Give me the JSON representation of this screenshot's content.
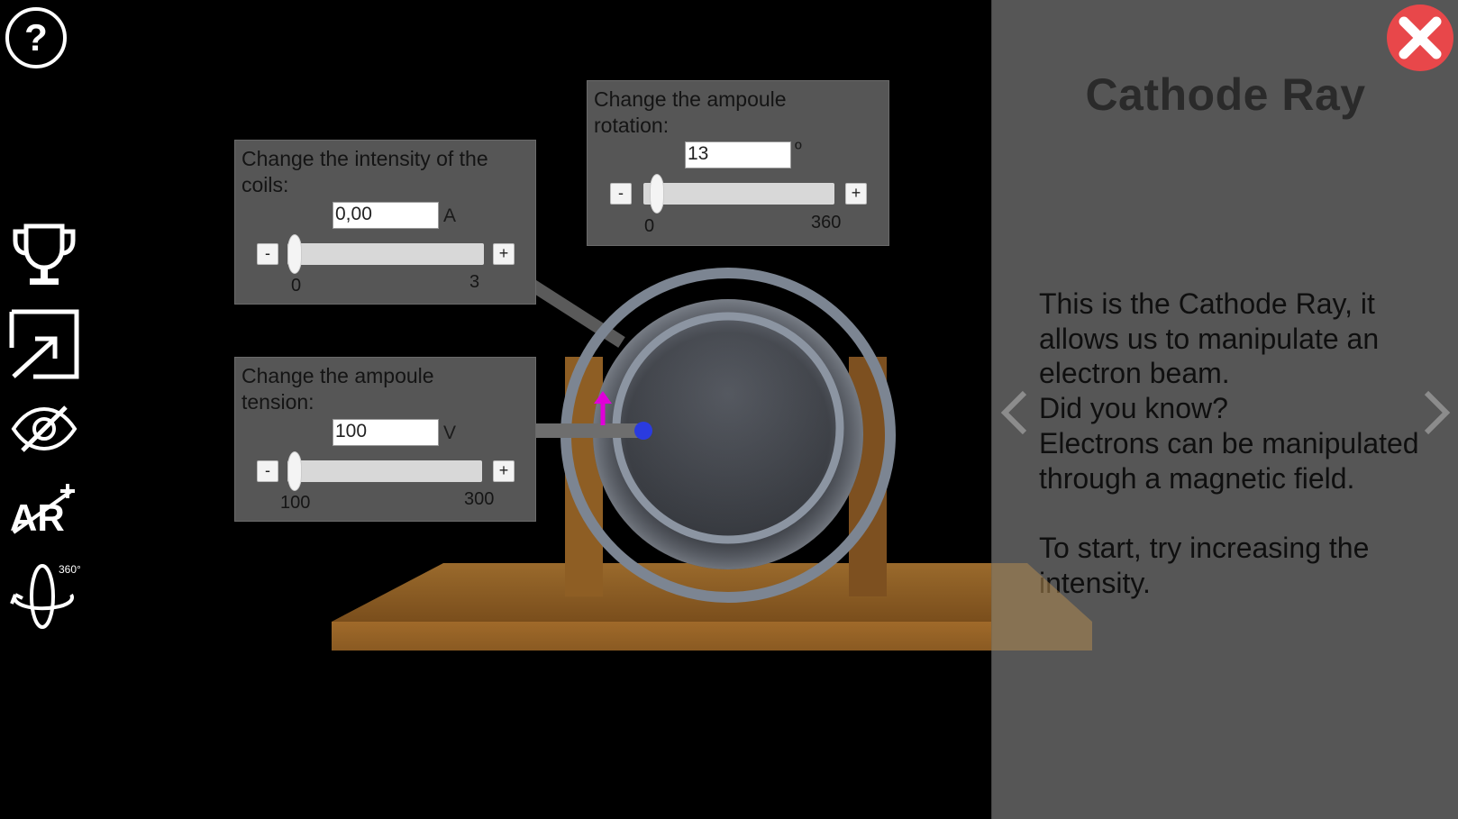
{
  "toolbar": {
    "items": [
      {
        "name": "help-icon"
      },
      {
        "name": "trophy-icon"
      },
      {
        "name": "share-icon"
      },
      {
        "name": "hide-icon"
      },
      {
        "name": "ar-icon"
      },
      {
        "name": "rotate-360-icon",
        "badge": "360°"
      }
    ]
  },
  "coils": {
    "title": "Change the intensity of the coils:",
    "value": "0,00",
    "unit": "A",
    "min": "0",
    "max": "3",
    "minus": "-",
    "plus": "+",
    "level": 0
  },
  "tension": {
    "title": "Change the ampoule tension:",
    "value": "100",
    "unit": "V",
    "min": "100",
    "max": "300",
    "minus": "-",
    "plus": "+",
    "level": 0
  },
  "rotation": {
    "title": "Change the ampoule rotation:",
    "value": "13",
    "unit": "º",
    "min": "0",
    "max": "360",
    "minus": "-",
    "plus": "+",
    "level": 0.036
  },
  "info": {
    "heading": "Cathode Ray",
    "body": "This is the Cathode Ray, it allows us to manipulate an electron beam.\nDid you know?\nElectrons can be manipulated through a magnetic field.\n\nTo start, try increasing the intensity."
  },
  "colors": {
    "panel": "#565656",
    "close": "#e8474a",
    "wood": "#8a5a24",
    "beam_arrow": "#e000d8",
    "electron": "#2a3be0"
  }
}
